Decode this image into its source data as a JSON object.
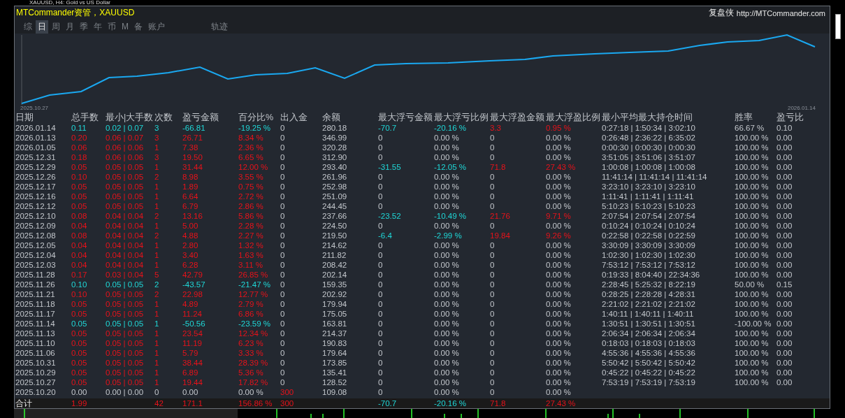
{
  "chart_window_title": "XAUUSD, H4:  Gold vs US Dollar",
  "panel": {
    "title": "MTCommander资管，XAUUSD",
    "brand": "复盘侠",
    "url": "http://MTCommander.com"
  },
  "tabs": [
    {
      "label": "综",
      "selected": false
    },
    {
      "label": "日",
      "selected": true
    },
    {
      "label": "周",
      "selected": false
    },
    {
      "label": "月",
      "selected": false
    },
    {
      "label": "季",
      "selected": false
    },
    {
      "label": "年",
      "selected": false
    },
    {
      "label": "币",
      "selected": false
    },
    {
      "label": "M",
      "selected": false
    },
    {
      "label": "备",
      "selected": false
    },
    {
      "label": "账户",
      "selected": false
    }
  ],
  "track_tab": {
    "label": "轨迹",
    "selected": false
  },
  "equity_chart": {
    "start_label": "2025.10.27",
    "end_label": "2026.01.14"
  },
  "table": {
    "columns": [
      "日期",
      "总手数",
      "最小|大手数",
      "次数",
      "盈亏金额",
      "百分比%",
      "出入金",
      "余额",
      "最大浮亏金额",
      "最大浮亏比例",
      "最大浮盈金额",
      "最大浮盈比例",
      "最小平均最大持仓时间",
      "胜率",
      "盈亏比"
    ],
    "rows": [
      {
        "loss": true,
        "profit": false,
        "deposit": false,
        "float_loss": true,
        "float_profit": true,
        "cells": [
          "2026.01.14",
          "0.11",
          "0.02 | 0.07",
          "3",
          "-66.81",
          "-19.25 %",
          "0",
          "280.18",
          "-70.7",
          "-20.16 %",
          "3.3",
          "0.95 %",
          "0:27:18 | 1:50:34 | 3:02:10",
          "66.67 %",
          "0.10"
        ]
      },
      {
        "loss": false,
        "profit": true,
        "deposit": false,
        "float_loss": false,
        "float_profit": false,
        "cells": [
          "2026.01.13",
          "0.20",
          "0.06 | 0.07",
          "3",
          "26.71",
          "8.34 %",
          "0",
          "346.99",
          "0",
          "0.00 %",
          "0",
          "0.00 %",
          "0:26:48 | 2:36:22 | 6:35:02",
          "100.00 %",
          "0.00"
        ]
      },
      {
        "loss": false,
        "profit": true,
        "deposit": false,
        "float_loss": false,
        "float_profit": false,
        "cells": [
          "2026.01.05",
          "0.06",
          "0.06 | 0.06",
          "1",
          "7.38",
          "2.36 %",
          "0",
          "320.28",
          "0",
          "0.00 %",
          "0",
          "0.00 %",
          "0:00:30 | 0:00:30 | 0:00:30",
          "100.00 %",
          "0.00"
        ]
      },
      {
        "loss": false,
        "profit": true,
        "deposit": false,
        "float_loss": false,
        "float_profit": false,
        "cells": [
          "2025.12.31",
          "0.18",
          "0.06 | 0.06",
          "3",
          "19.50",
          "6.65 %",
          "0",
          "312.90",
          "0",
          "0.00 %",
          "0",
          "0.00 %",
          "3:51:05 | 3:51:06 | 3:51:07",
          "100.00 %",
          "0.00"
        ]
      },
      {
        "loss": false,
        "profit": true,
        "deposit": false,
        "float_loss": true,
        "float_profit": true,
        "cells": [
          "2025.12.29",
          "0.05",
          "0.05 | 0.05",
          "1",
          "31.44",
          "12.00 %",
          "0",
          "293.40",
          "-31.55",
          "-12.05 %",
          "71.8",
          "27.43 %",
          "1:00:08 | 1:00:08 | 1:00:08",
          "100.00 %",
          "0.00"
        ]
      },
      {
        "loss": false,
        "profit": true,
        "deposit": false,
        "float_loss": false,
        "float_profit": false,
        "cells": [
          "2025.12.26",
          "0.10",
          "0.05 | 0.05",
          "2",
          "8.98",
          "3.55 %",
          "0",
          "261.96",
          "0",
          "0.00 %",
          "0",
          "0.00 %",
          "11:41:14 | 11:41:14 | 11:41:14",
          "100.00 %",
          "0.00"
        ]
      },
      {
        "loss": false,
        "profit": true,
        "deposit": false,
        "float_loss": false,
        "float_profit": false,
        "cells": [
          "2025.12.17",
          "0.05",
          "0.05 | 0.05",
          "1",
          "1.89",
          "0.75 %",
          "0",
          "252.98",
          "0",
          "0.00 %",
          "0",
          "0.00 %",
          "3:23:10 | 3:23:10 | 3:23:10",
          "100.00 %",
          "0.00"
        ]
      },
      {
        "loss": false,
        "profit": true,
        "deposit": false,
        "float_loss": false,
        "float_profit": false,
        "cells": [
          "2025.12.16",
          "0.05",
          "0.05 | 0.05",
          "1",
          "6.64",
          "2.72 %",
          "0",
          "251.09",
          "0",
          "0.00 %",
          "0",
          "0.00 %",
          "1:11:41 | 1:11:41 | 1:11:41",
          "100.00 %",
          "0.00"
        ]
      },
      {
        "loss": false,
        "profit": true,
        "deposit": false,
        "float_loss": false,
        "float_profit": false,
        "cells": [
          "2025.12.12",
          "0.05",
          "0.05 | 0.05",
          "1",
          "6.79",
          "2.86 %",
          "0",
          "244.45",
          "0",
          "0.00 %",
          "0",
          "0.00 %",
          "5:10:23 | 5:10:23 | 5:10:23",
          "100.00 %",
          "0.00"
        ]
      },
      {
        "loss": false,
        "profit": true,
        "deposit": false,
        "float_loss": true,
        "float_profit": true,
        "cells": [
          "2025.12.10",
          "0.08",
          "0.04 | 0.04",
          "2",
          "13.16",
          "5.86 %",
          "0",
          "237.66",
          "-23.52",
          "-10.49 %",
          "21.76",
          "9.71 %",
          "2:07:54 | 2:07:54 | 2:07:54",
          "100.00 %",
          "0.00"
        ]
      },
      {
        "loss": false,
        "profit": true,
        "deposit": false,
        "float_loss": false,
        "float_profit": false,
        "cells": [
          "2025.12.09",
          "0.04",
          "0.04 | 0.04",
          "1",
          "5.00",
          "2.28 %",
          "0",
          "224.50",
          "0",
          "0.00 %",
          "0",
          "0.00 %",
          "0:10:24 | 0:10:24 | 0:10:24",
          "100.00 %",
          "0.00"
        ]
      },
      {
        "loss": false,
        "profit": true,
        "deposit": false,
        "float_loss": true,
        "float_profit": true,
        "cells": [
          "2025.12.08",
          "0.08",
          "0.04 | 0.04",
          "2",
          "4.88",
          "2.27 %",
          "0",
          "219.50",
          "-6.4",
          "-2.99 %",
          "19.84",
          "9.26 %",
          "0:22:58 | 0:22:58 | 0:22:59",
          "100.00 %",
          "0.00"
        ]
      },
      {
        "loss": false,
        "profit": true,
        "deposit": false,
        "float_loss": false,
        "float_profit": false,
        "cells": [
          "2025.12.05",
          "0.04",
          "0.04 | 0.04",
          "1",
          "2.80",
          "1.32 %",
          "0",
          "214.62",
          "0",
          "0.00 %",
          "0",
          "0.00 %",
          "3:30:09 | 3:30:09 | 3:30:09",
          "100.00 %",
          "0.00"
        ]
      },
      {
        "loss": false,
        "profit": true,
        "deposit": false,
        "float_loss": false,
        "float_profit": false,
        "cells": [
          "2025.12.04",
          "0.04",
          "0.04 | 0.04",
          "1",
          "3.40",
          "1.63 %",
          "0",
          "211.82",
          "0",
          "0.00 %",
          "0",
          "0.00 %",
          "1:02:30 | 1:02:30 | 1:02:30",
          "100.00 %",
          "0.00"
        ]
      },
      {
        "loss": false,
        "profit": true,
        "deposit": false,
        "float_loss": false,
        "float_profit": false,
        "cells": [
          "2025.12.03",
          "0.04",
          "0.04 | 0.04",
          "1",
          "6.28",
          "3.11 %",
          "0",
          "208.42",
          "0",
          "0.00 %",
          "0",
          "0.00 %",
          "7:53:12 | 7:53:12 | 7:53:12",
          "100.00 %",
          "0.00"
        ]
      },
      {
        "loss": false,
        "profit": true,
        "deposit": false,
        "float_loss": false,
        "float_profit": false,
        "cells": [
          "2025.11.28",
          "0.17",
          "0.03 | 0.04",
          "5",
          "42.79",
          "26.85 %",
          "0",
          "202.14",
          "0",
          "0.00 %",
          "0",
          "0.00 %",
          "0:19:33 | 8:04:40 | 22:34:36",
          "100.00 %",
          "0.00"
        ]
      },
      {
        "loss": true,
        "profit": false,
        "deposit": false,
        "float_loss": false,
        "float_profit": false,
        "cells": [
          "2025.11.26",
          "0.10",
          "0.05 | 0.05",
          "2",
          "-43.57",
          "-21.47 %",
          "0",
          "159.35",
          "0",
          "0.00 %",
          "0",
          "0.00 %",
          "2:28:45 | 5:25:32 | 8:22:19",
          "50.00 %",
          "0.15"
        ]
      },
      {
        "loss": false,
        "profit": true,
        "deposit": false,
        "float_loss": false,
        "float_profit": false,
        "cells": [
          "2025.11.21",
          "0.10",
          "0.05 | 0.05",
          "2",
          "22.98",
          "12.77 %",
          "0",
          "202.92",
          "0",
          "0.00 %",
          "0",
          "0.00 %",
          "0:28:25 | 2:28:28 | 4:28:31",
          "100.00 %",
          "0.00"
        ]
      },
      {
        "loss": false,
        "profit": true,
        "deposit": false,
        "float_loss": false,
        "float_profit": false,
        "cells": [
          "2025.11.18",
          "0.05",
          "0.05 | 0.05",
          "1",
          "4.89",
          "2.79 %",
          "0",
          "179.94",
          "0",
          "0.00 %",
          "0",
          "0.00 %",
          "2:21:02 | 2:21:02 | 2:21:02",
          "100.00 %",
          "0.00"
        ]
      },
      {
        "loss": false,
        "profit": true,
        "deposit": false,
        "float_loss": false,
        "float_profit": false,
        "cells": [
          "2025.11.17",
          "0.05",
          "0.05 | 0.05",
          "1",
          "11.24",
          "6.86 %",
          "0",
          "175.05",
          "0",
          "0.00 %",
          "0",
          "0.00 %",
          "1:40:11 | 1:40:11 | 1:40:11",
          "100.00 %",
          "0.00"
        ]
      },
      {
        "loss": true,
        "profit": false,
        "deposit": false,
        "float_loss": false,
        "float_profit": false,
        "cells": [
          "2025.11.14",
          "0.05",
          "0.05 | 0.05",
          "1",
          "-50.56",
          "-23.59 %",
          "0",
          "163.81",
          "0",
          "0.00 %",
          "0",
          "0.00 %",
          "1:30:51 | 1:30:51 | 1:30:51",
          "-100.00 %",
          "0.00"
        ]
      },
      {
        "loss": false,
        "profit": true,
        "deposit": false,
        "float_loss": false,
        "float_profit": false,
        "cells": [
          "2025.11.13",
          "0.05",
          "0.05 | 0.05",
          "1",
          "23.54",
          "12.34 %",
          "0",
          "214.37",
          "0",
          "0.00 %",
          "0",
          "0.00 %",
          "2:06:34 | 2:06:34 | 2:06:34",
          "100.00 %",
          "0.00"
        ]
      },
      {
        "loss": false,
        "profit": true,
        "deposit": false,
        "float_loss": false,
        "float_profit": false,
        "cells": [
          "2025.11.10",
          "0.05",
          "0.05 | 0.05",
          "1",
          "11.19",
          "6.23 %",
          "0",
          "190.83",
          "0",
          "0.00 %",
          "0",
          "0.00 %",
          "0:18:03 | 0:18:03 | 0:18:03",
          "100.00 %",
          "0.00"
        ]
      },
      {
        "loss": false,
        "profit": true,
        "deposit": false,
        "float_loss": false,
        "float_profit": false,
        "cells": [
          "2025.11.06",
          "0.05",
          "0.05 | 0.05",
          "1",
          "5.79",
          "3.33 %",
          "0",
          "179.64",
          "0",
          "0.00 %",
          "0",
          "0.00 %",
          "4:55:36 | 4:55:36 | 4:55:36",
          "100.00 %",
          "0.00"
        ]
      },
      {
        "loss": false,
        "profit": true,
        "deposit": false,
        "float_loss": false,
        "float_profit": false,
        "cells": [
          "2025.10.31",
          "0.05",
          "0.05 | 0.05",
          "1",
          "38.44",
          "28.39 %",
          "0",
          "173.85",
          "0",
          "0.00 %",
          "0",
          "0.00 %",
          "5:50:42 | 5:50:42 | 5:50:42",
          "100.00 %",
          "0.00"
        ]
      },
      {
        "loss": false,
        "profit": true,
        "deposit": false,
        "float_loss": false,
        "float_profit": false,
        "cells": [
          "2025.10.29",
          "0.05",
          "0.05 | 0.05",
          "1",
          "6.89",
          "5.36 %",
          "0",
          "135.41",
          "0",
          "0.00 %",
          "0",
          "0.00 %",
          "0:45:22 | 0:45:22 | 0:45:22",
          "100.00 %",
          "0.00"
        ]
      },
      {
        "loss": false,
        "profit": true,
        "deposit": false,
        "float_loss": false,
        "float_profit": false,
        "cells": [
          "2025.10.27",
          "0.05",
          "0.05 | 0.05",
          "1",
          "19.44",
          "17.82 %",
          "0",
          "128.52",
          "0",
          "0.00 %",
          "0",
          "0.00 %",
          "7:53:19 | 7:53:19 | 7:53:19",
          "100.00 %",
          "0.00"
        ]
      },
      {
        "loss": false,
        "profit": false,
        "deposit": true,
        "float_loss": false,
        "float_profit": false,
        "cells": [
          "2025.10.20",
          "0.00",
          "0.00 | 0.00",
          "0",
          "0.00",
          "0.00 %",
          "300",
          "109.08",
          "0",
          "0.00 %",
          "0",
          "0.00 %"
        ]
      }
    ],
    "total": {
      "loss": false,
      "profit": true,
      "deposit": true,
      "float_loss": true,
      "float_profit": true,
      "cells": {
        "date": "合计",
        "lots": "1.99",
        "count": "42",
        "pnl": "171.1",
        "pct": "156.86 %",
        "deposit": "300",
        "max_float_loss": "-70.7",
        "max_float_loss_pct": "-20.16 %",
        "max_float_profit": "71.8",
        "max_float_profit_pct": "27.43 %"
      }
    }
  }
}
